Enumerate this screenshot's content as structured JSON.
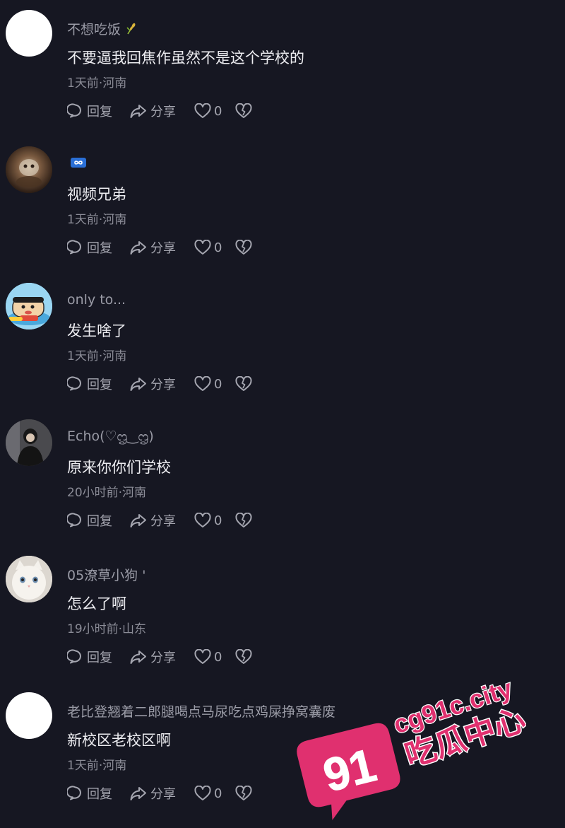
{
  "comments": [
    {
      "username": "不想吃饭",
      "badge": "rice-plant",
      "text": "不要逼我回焦作虽然不是这个学校的",
      "meta": "1天前·河南",
      "reply_label": "回复",
      "share_label": "分享",
      "like_count": "0",
      "avatar": "blank"
    },
    {
      "username": "",
      "badge": "infinity-emoji",
      "text": "视频兄弟",
      "meta": "1天前·河南",
      "reply_label": "回复",
      "share_label": "分享",
      "like_count": "0",
      "avatar": "dark-photo"
    },
    {
      "username": "only to...",
      "badge": "",
      "text": "发生啥了",
      "meta": "1天前·河南",
      "reply_label": "回复",
      "share_label": "分享",
      "like_count": "0",
      "avatar": "cartoon"
    },
    {
      "username": "Echo(♡ᦗ‿ᦗ)",
      "badge": "",
      "text": "原来你你们学校",
      "meta": "20小时前·河南",
      "reply_label": "回复",
      "share_label": "分享",
      "like_count": "0",
      "avatar": "person-dark"
    },
    {
      "username": "05潦草小狗 '",
      "badge": "",
      "text": "怎么了啊",
      "meta": "19小时前·山东",
      "reply_label": "回复",
      "share_label": "分享",
      "like_count": "0",
      "avatar": "white-cat"
    },
    {
      "username": "老比登翘着二郎腿喝点马尿吃点鸡屎挣窝囊废",
      "badge": "",
      "text": "新校区老校区啊",
      "meta": "1天前·河南",
      "reply_label": "回复",
      "share_label": "分享",
      "like_count": "0",
      "avatar": "blank"
    }
  ],
  "watermark": {
    "number": "91",
    "domain": "cg91c.city",
    "brand": "吃瓜中心"
  },
  "colors": {
    "background": "#161722",
    "text_primary": "#ececf0",
    "text_secondary": "#8b8c97",
    "watermark_pink": "#e0306f"
  }
}
